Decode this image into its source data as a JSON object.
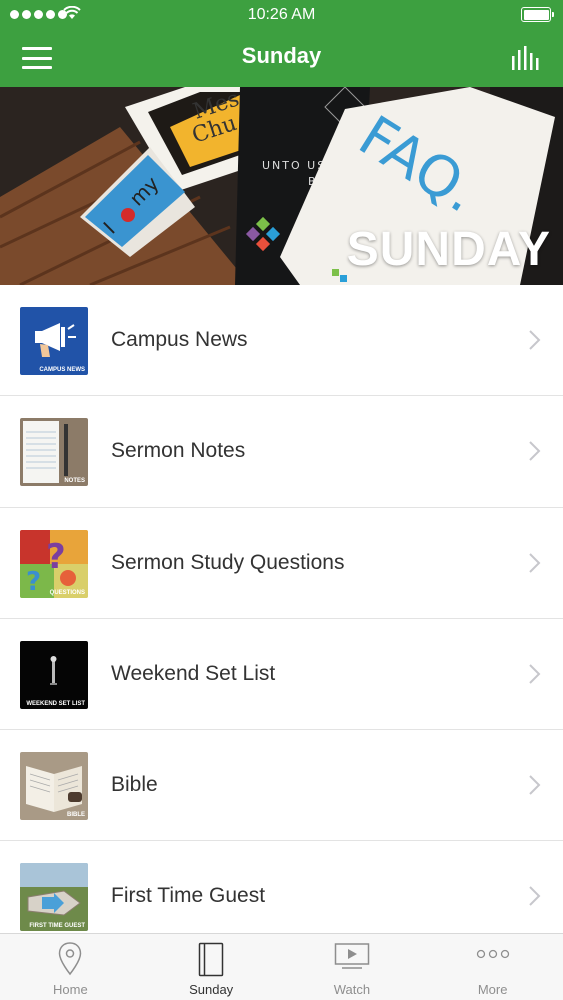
{
  "status_bar": {
    "time": "10:26 AM"
  },
  "nav": {
    "title": "Sunday"
  },
  "hero": {
    "title": "SUNDAY"
  },
  "list": {
    "items": [
      {
        "label": "Campus News",
        "caption": "CAMPUS NEWS",
        "icon": "megaphone-icon"
      },
      {
        "label": "Sermon Notes",
        "caption": "NOTES",
        "icon": "notebook-icon"
      },
      {
        "label": "Sermon Study Questions",
        "caption": "QUESTIONS",
        "icon": "question-marks-icon"
      },
      {
        "label": "Weekend Set List",
        "caption": "WEEKEND SET LIST",
        "icon": "microphone-icon"
      },
      {
        "label": "Bible",
        "caption": "BIBLE",
        "icon": "book-icon"
      },
      {
        "label": "First Time Guest",
        "caption": "FIRST TIME GUEST",
        "icon": "sign-icon"
      }
    ]
  },
  "tab_bar": {
    "tabs": [
      {
        "label": "Home",
        "icon": "location-pin-icon"
      },
      {
        "label": "Sunday",
        "icon": "book-tab-icon",
        "active": true
      },
      {
        "label": "Watch",
        "icon": "play-screen-icon"
      },
      {
        "label": "More",
        "icon": "more-dots-icon"
      }
    ]
  },
  "colors": {
    "brand_green": "#3da040",
    "tab_inactive": "#8e8e8e",
    "chevron": "#c7c7cc"
  }
}
